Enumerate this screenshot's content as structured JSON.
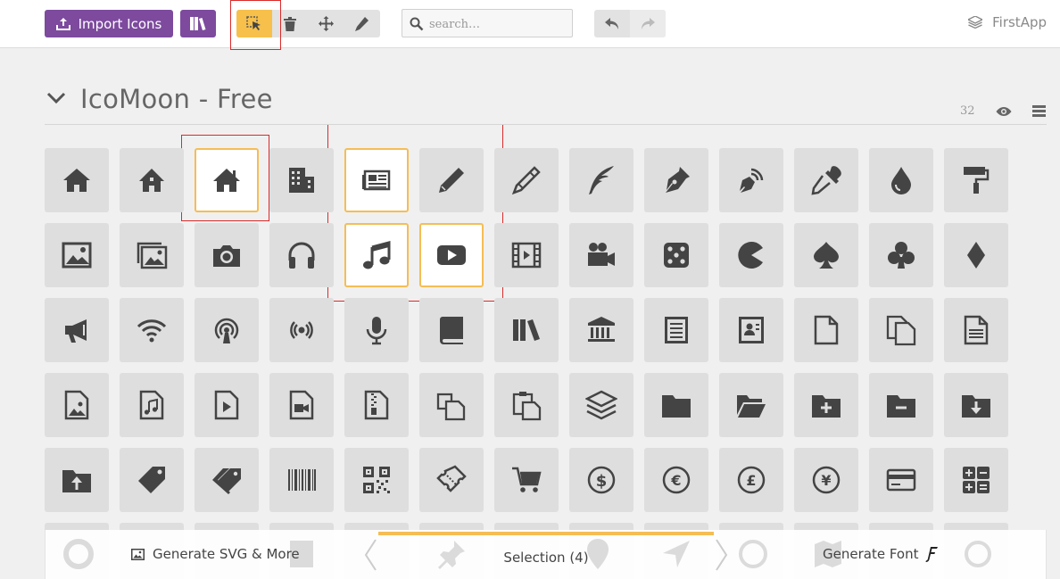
{
  "toolbar": {
    "import_label": "Import Icons",
    "search_placeholder": "search…",
    "project_name": "FirstApp",
    "tools": [
      "select-icon",
      "trash-icon",
      "move-icon",
      "pencil-icon"
    ]
  },
  "section": {
    "title": "IcoMoon - Free",
    "count": "32"
  },
  "bottom": {
    "svg_label": "Generate SVG & More",
    "selection_label": "Selection (4)",
    "font_label": "Generate Font"
  },
  "colors": {
    "brand": "#7d4a9e",
    "accent": "#f5bd55",
    "tile": "#dedede",
    "annotation": "#d92b2b"
  },
  "icons": [
    [
      "home",
      "home2",
      "home3",
      "office",
      "newspaper",
      "pencil",
      "pencil2",
      "quill",
      "pen",
      "blog",
      "eyedropper",
      "droplet",
      "paint-format"
    ],
    [
      "image",
      "images",
      "camera",
      "headphones",
      "music",
      "play",
      "film",
      "video-camera",
      "dice",
      "pacman",
      "spades",
      "clubs",
      "diamonds"
    ],
    [
      "bullhorn",
      "connection",
      "podcast",
      "feed",
      "mic",
      "book",
      "books",
      "library",
      "file-text",
      "profile",
      "file-empty",
      "files-empty",
      "file-text2"
    ],
    [
      "file-picture",
      "file-music",
      "file-play",
      "file-video",
      "file-zip",
      "copy",
      "paste",
      "stack",
      "folder",
      "folder-open",
      "folder-plus",
      "folder-minus",
      "folder-download"
    ],
    [
      "folder-upload",
      "price-tag",
      "price-tags",
      "barcode",
      "qrcode",
      "ticket",
      "cart",
      "coin-dollar",
      "coin-euro",
      "coin-pound",
      "coin-yen",
      "credit-card",
      "calculator"
    ]
  ],
  "selected_icons": [
    "home3",
    "newspaper",
    "music",
    "play"
  ]
}
